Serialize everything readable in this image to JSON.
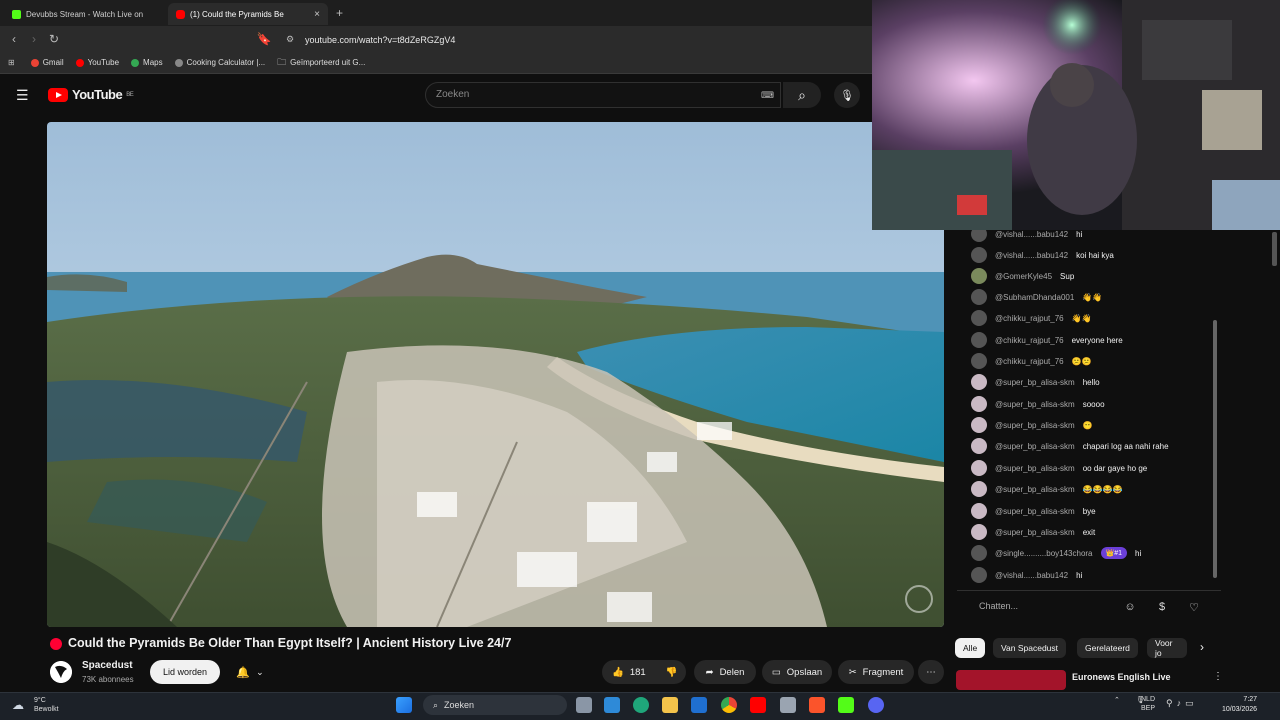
{
  "browser": {
    "tabs": [
      {
        "label": "Devubbs Stream - Watch Live on",
        "active": false
      },
      {
        "label": "(1)  Could the Pyramids Be",
        "active": true
      }
    ],
    "new_tab": "+",
    "tab_close": "×",
    "url": "youtube.com/watch?v=t8dZeRGZgV4",
    "bookmarks": [
      "Gmail",
      "YouTube",
      "Maps",
      "Cooking Calculator |...",
      "Geïmporteerd uit G..."
    ]
  },
  "youtube": {
    "logo_text": "YouTube",
    "region": "BE",
    "search_placeholder": "Zoeken"
  },
  "video": {
    "title": "Could the Pyramids Be Older Than Egypt Itself? | Ancient History Live 24/7",
    "channel": "Spacedust",
    "subscribers": "73K abonnees",
    "join_label": "Lid worden",
    "likes": "181",
    "share_label": "Delen",
    "save_label": "Opslaan",
    "clip_label": "Fragment"
  },
  "chat": {
    "messages": [
      {
        "author": "@vishal......babu142",
        "text": "hi"
      },
      {
        "author": "@vishal......babu142",
        "text": "koi hai kya"
      },
      {
        "author": "@GomerKyle45",
        "text": "Sup"
      },
      {
        "author": "@SubhamDhanda001",
        "text": "👋👋"
      },
      {
        "author": "@chikku_rajput_76",
        "text": "👋👋"
      },
      {
        "author": "@chikku_rajput_76",
        "text": "everyone here"
      },
      {
        "author": "@chikku_rajput_76",
        "text": "😕😕"
      },
      {
        "author": "@super_bp_alisa-skm",
        "text": "hello"
      },
      {
        "author": "@super_bp_alisa-skm",
        "text": "soooo"
      },
      {
        "author": "@super_bp_alisa-skm",
        "text": "😶"
      },
      {
        "author": "@super_bp_alisa-skm",
        "text": "chapari log aa nahi rahe"
      },
      {
        "author": "@super_bp_alisa-skm",
        "text": "oo dar gaye ho ge"
      },
      {
        "author": "@super_bp_alisa-skm",
        "text": "😂😂😂😂"
      },
      {
        "author": "@super_bp_alisa-skm",
        "text": "bye"
      },
      {
        "author": "@super_bp_alisa-skm",
        "text": "exit"
      },
      {
        "author": "@single..........boy143chora",
        "badge": "👑#1",
        "text": "hi"
      },
      {
        "author": "@vishal......babu142",
        "text": "hi"
      }
    ],
    "input_placeholder": "Chatten..."
  },
  "chips": [
    "Alle",
    "Van Spacedust",
    "Gerelateerd",
    "Voor jo"
  ],
  "recommendation": {
    "title": "Euronews English Live"
  },
  "taskbar": {
    "temp": "9°C",
    "weather": "Bewolkt",
    "search_label": "Zoeken",
    "lang_top": "NLD",
    "lang_bottom": "BEP",
    "time": "7:27",
    "date": "10/03/2026"
  },
  "colors": {
    "yt_red": "#ff0000",
    "live_red": "#ff0033",
    "background": "#0f0f0f",
    "membership_purple": "#6b3fd8"
  }
}
